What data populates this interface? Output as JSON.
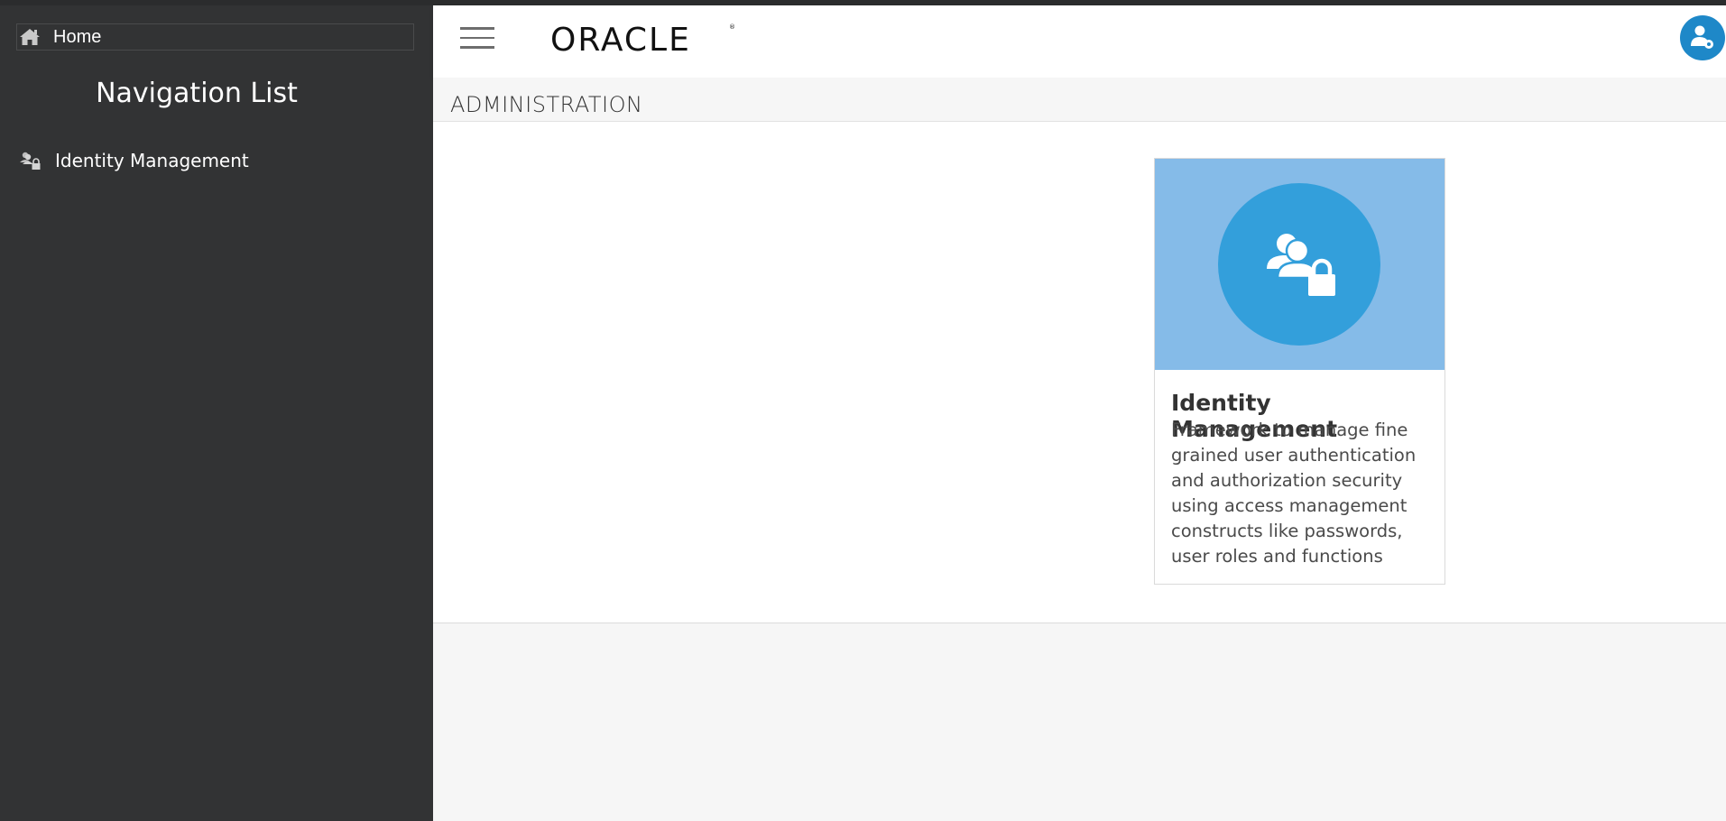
{
  "sidebar": {
    "home_label": "Home",
    "home_icon": "home-icon",
    "title": "Navigation List",
    "items": [
      {
        "label": "Identity Management",
        "icon": "identity-lock-icon"
      }
    ]
  },
  "header": {
    "menu_icon": "hamburger-menu-icon",
    "logo_text": "ORACLE",
    "avatar_icon": "user-settings-icon",
    "accent_color": "#1e88c8"
  },
  "page": {
    "title": "ADMINISTRATION"
  },
  "cards": [
    {
      "title": "Identity Management",
      "description": "Framework to manage fine grained user authentication and authorization security using access management constructs like passwords, user roles and functions",
      "icon": "users-lock-icon",
      "banner_color": "#85bbe8",
      "circle_color": "#339fdb"
    }
  ]
}
